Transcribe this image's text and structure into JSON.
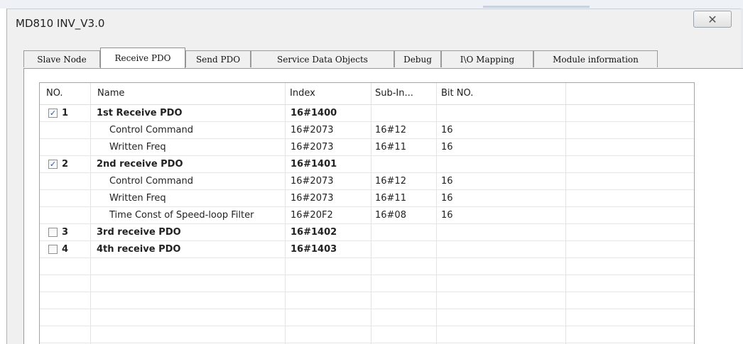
{
  "window": {
    "title": "MD810 INV_V3.0",
    "close_glyph": "✕"
  },
  "tabs": [
    {
      "label": "Slave Node",
      "active": false
    },
    {
      "label": "Receive PDO",
      "active": true
    },
    {
      "label": "Send PDO",
      "active": false
    },
    {
      "label": "Service Data Objects",
      "active": false
    },
    {
      "label": "Debug",
      "active": false
    },
    {
      "label": "I\\O Mapping",
      "active": false
    },
    {
      "label": "Module information",
      "active": false
    }
  ],
  "table": {
    "columns": [
      "NO.",
      "Name",
      "Index",
      "Sub-In...",
      "Bit NO."
    ],
    "rows": [
      {
        "type": "pdo",
        "checked": true,
        "no": "1",
        "name": "1st Receive PDO",
        "index": "16#1400",
        "sub": "",
        "bit": ""
      },
      {
        "type": "entry",
        "name": "Control Command",
        "index": "16#2073",
        "sub": "16#12",
        "bit": "16"
      },
      {
        "type": "entry",
        "name": "Written Freq",
        "index": "16#2073",
        "sub": "16#11",
        "bit": "16"
      },
      {
        "type": "pdo",
        "checked": true,
        "no": "2",
        "name": "2nd receive PDO",
        "index": "16#1401",
        "sub": "",
        "bit": ""
      },
      {
        "type": "entry",
        "name": "Control Command",
        "index": "16#2073",
        "sub": "16#12",
        "bit": "16"
      },
      {
        "type": "entry",
        "name": "Written Freq",
        "index": "16#2073",
        "sub": "16#11",
        "bit": "16"
      },
      {
        "type": "entry",
        "name": "Time Const of Speed-loop Filter",
        "index": "16#20F2",
        "sub": "16#08",
        "bit": "16"
      },
      {
        "type": "pdo",
        "checked": false,
        "no": "3",
        "name": "3rd receive PDO",
        "index": "16#1402",
        "sub": "",
        "bit": ""
      },
      {
        "type": "pdo",
        "checked": false,
        "no": "4",
        "name": "4th receive PDO",
        "index": "16#1403",
        "sub": "",
        "bit": ""
      }
    ]
  },
  "colors": {
    "check_mark": "#2a57a8",
    "grid_line": "#e6e6e6",
    "frame": "#f0f0f0"
  },
  "icons": {
    "close": "close-icon",
    "checkbox": "checkbox-icon"
  }
}
